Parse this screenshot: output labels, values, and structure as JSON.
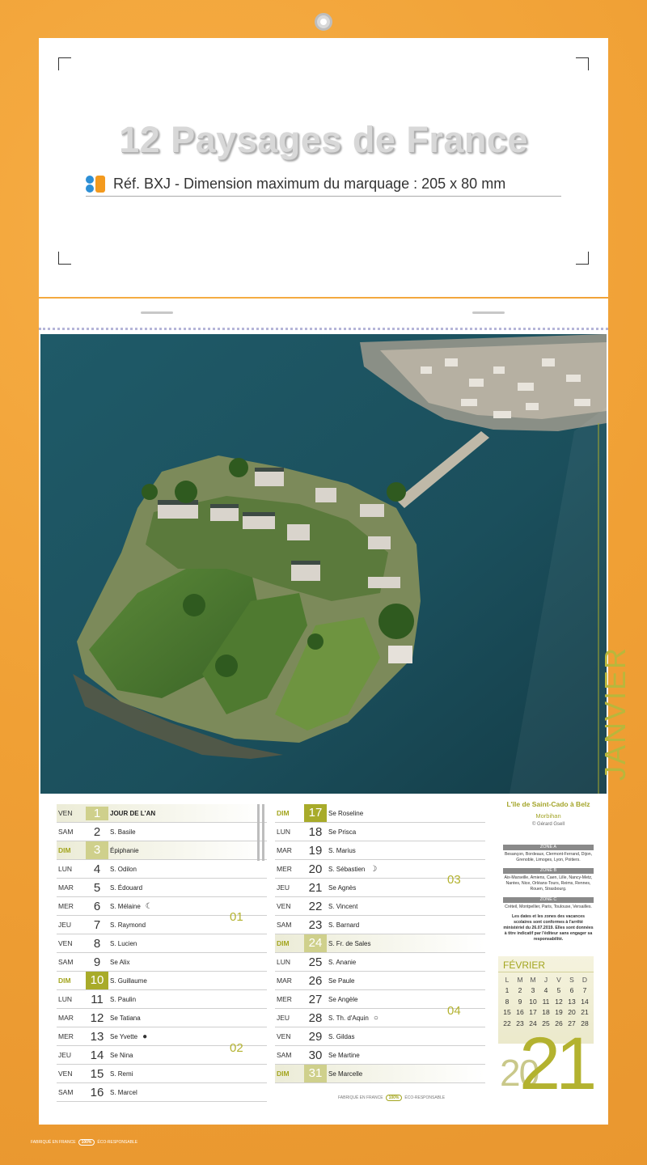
{
  "header": {
    "title": "12 Paysages de France",
    "ref": "Réf. BXJ - Dimension maximum du marquage : 205 x 80 mm"
  },
  "month": {
    "name": "JANVIER",
    "year_small": "20",
    "year_large": "21"
  },
  "photo": {
    "location": "L'île de Saint-Cado à Belz",
    "region": "Morbihan",
    "credit": "© Gérard Gsell"
  },
  "days_col1": [
    {
      "dname": "VEN",
      "num": "1",
      "saint": "JOUR DE L'AN",
      "sun": false,
      "hl": true,
      "moon": ""
    },
    {
      "dname": "SAM",
      "num": "2",
      "saint": "S. Basile",
      "sun": false,
      "hl": false,
      "moon": ""
    },
    {
      "dname": "DIM",
      "num": "3",
      "saint": "Épiphanie",
      "sun": true,
      "hl": true,
      "moon": ""
    },
    {
      "dname": "LUN",
      "num": "4",
      "saint": "S. Odilon",
      "sun": false,
      "hl": false,
      "moon": ""
    },
    {
      "dname": "MAR",
      "num": "5",
      "saint": "S. Édouard",
      "sun": false,
      "hl": false,
      "moon": ""
    },
    {
      "dname": "MER",
      "num": "6",
      "saint": "S. Mélaine",
      "sun": false,
      "hl": false,
      "moon": "☾"
    },
    {
      "dname": "JEU",
      "num": "7",
      "saint": "S. Raymond",
      "sun": false,
      "hl": false,
      "moon": ""
    },
    {
      "dname": "VEN",
      "num": "8",
      "saint": "S. Lucien",
      "sun": false,
      "hl": false,
      "moon": ""
    },
    {
      "dname": "SAM",
      "num": "9",
      "saint": "Se Alix",
      "sun": false,
      "hl": false,
      "moon": ""
    },
    {
      "dname": "DIM",
      "num": "10",
      "saint": "S. Guillaume",
      "sun": true,
      "hl": false,
      "moon": ""
    },
    {
      "dname": "LUN",
      "num": "11",
      "saint": "S. Paulin",
      "sun": false,
      "hl": false,
      "moon": ""
    },
    {
      "dname": "MAR",
      "num": "12",
      "saint": "Se Tatiana",
      "sun": false,
      "hl": false,
      "moon": ""
    },
    {
      "dname": "MER",
      "num": "13",
      "saint": "Se Yvette",
      "sun": false,
      "hl": false,
      "moon": "●"
    },
    {
      "dname": "JEU",
      "num": "14",
      "saint": "Se Nina",
      "sun": false,
      "hl": false,
      "moon": ""
    },
    {
      "dname": "VEN",
      "num": "15",
      "saint": "S. Remi",
      "sun": false,
      "hl": false,
      "moon": ""
    },
    {
      "dname": "SAM",
      "num": "16",
      "saint": "S. Marcel",
      "sun": false,
      "hl": false,
      "moon": ""
    }
  ],
  "days_col2": [
    {
      "dname": "DIM",
      "num": "17",
      "saint": "Se Roseline",
      "sun": true,
      "hl": false,
      "moon": ""
    },
    {
      "dname": "LUN",
      "num": "18",
      "saint": "Se Prisca",
      "sun": false,
      "hl": false,
      "moon": ""
    },
    {
      "dname": "MAR",
      "num": "19",
      "saint": "S. Marius",
      "sun": false,
      "hl": false,
      "moon": ""
    },
    {
      "dname": "MER",
      "num": "20",
      "saint": "S. Sébastien",
      "sun": false,
      "hl": false,
      "moon": "☽"
    },
    {
      "dname": "JEU",
      "num": "21",
      "saint": "Se Agnès",
      "sun": false,
      "hl": false,
      "moon": ""
    },
    {
      "dname": "VEN",
      "num": "22",
      "saint": "S. Vincent",
      "sun": false,
      "hl": false,
      "moon": ""
    },
    {
      "dname": "SAM",
      "num": "23",
      "saint": "S. Barnard",
      "sun": false,
      "hl": false,
      "moon": ""
    },
    {
      "dname": "DIM",
      "num": "24",
      "saint": "S. Fr. de Sales",
      "sun": true,
      "hl": true,
      "moon": ""
    },
    {
      "dname": "LUN",
      "num": "25",
      "saint": "S. Ananie",
      "sun": false,
      "hl": false,
      "moon": ""
    },
    {
      "dname": "MAR",
      "num": "26",
      "saint": "Se Paule",
      "sun": false,
      "hl": false,
      "moon": ""
    },
    {
      "dname": "MER",
      "num": "27",
      "saint": "Se Angèle",
      "sun": false,
      "hl": false,
      "moon": ""
    },
    {
      "dname": "JEU",
      "num": "28",
      "saint": "S. Th. d'Aquin",
      "sun": false,
      "hl": false,
      "moon": "○"
    },
    {
      "dname": "VEN",
      "num": "29",
      "saint": "S. Gildas",
      "sun": false,
      "hl": false,
      "moon": ""
    },
    {
      "dname": "SAM",
      "num": "30",
      "saint": "Se Martine",
      "sun": false,
      "hl": false,
      "moon": ""
    },
    {
      "dname": "DIM",
      "num": "31",
      "saint": "Se Marcelle",
      "sun": true,
      "hl": true,
      "moon": ""
    }
  ],
  "weeks": [
    "01",
    "02",
    "03",
    "04"
  ],
  "zones": [
    {
      "title": "ZONE A",
      "text": "Besançon, Bordeaux, Clermont-Ferrand, Dijon, Grenoble, Limoges, Lyon, Poitiers."
    },
    {
      "title": "ZONE B",
      "text": "Aix-Marseille, Amiens, Caen, Lille, Nancy-Metz, Nantes, Nice, Orléans-Tours, Reims, Rennes, Rouen, Strasbourg."
    },
    {
      "title": "ZONE C",
      "text": "Créteil, Montpellier, Paris, Toulouse, Versailles."
    }
  ],
  "zone_note": "Les dates et les zones des vacances scolaires sont conformes à l'arrêté ministériel du 26.07.2019. Elles sont données à titre indicatif par l'éditeur sans engager sa responsabilité.",
  "mini_cal": {
    "title": "FÉVRIER",
    "headers": [
      "L",
      "M",
      "M",
      "J",
      "V",
      "S",
      "D"
    ],
    "weeks": [
      [
        "1",
        "2",
        "3",
        "4",
        "5",
        "6",
        "7"
      ],
      [
        "8",
        "9",
        "10",
        "11",
        "12",
        "13",
        "14"
      ],
      [
        "15",
        "16",
        "17",
        "18",
        "19",
        "20",
        "21"
      ],
      [
        "22",
        "23",
        "24",
        "25",
        "26",
        "27",
        "28"
      ]
    ]
  },
  "footer": {
    "left": "FABRIQUÉ EN FRANCE",
    "pill": "100%",
    "right": "ÉCO-RESPONSABLE"
  }
}
